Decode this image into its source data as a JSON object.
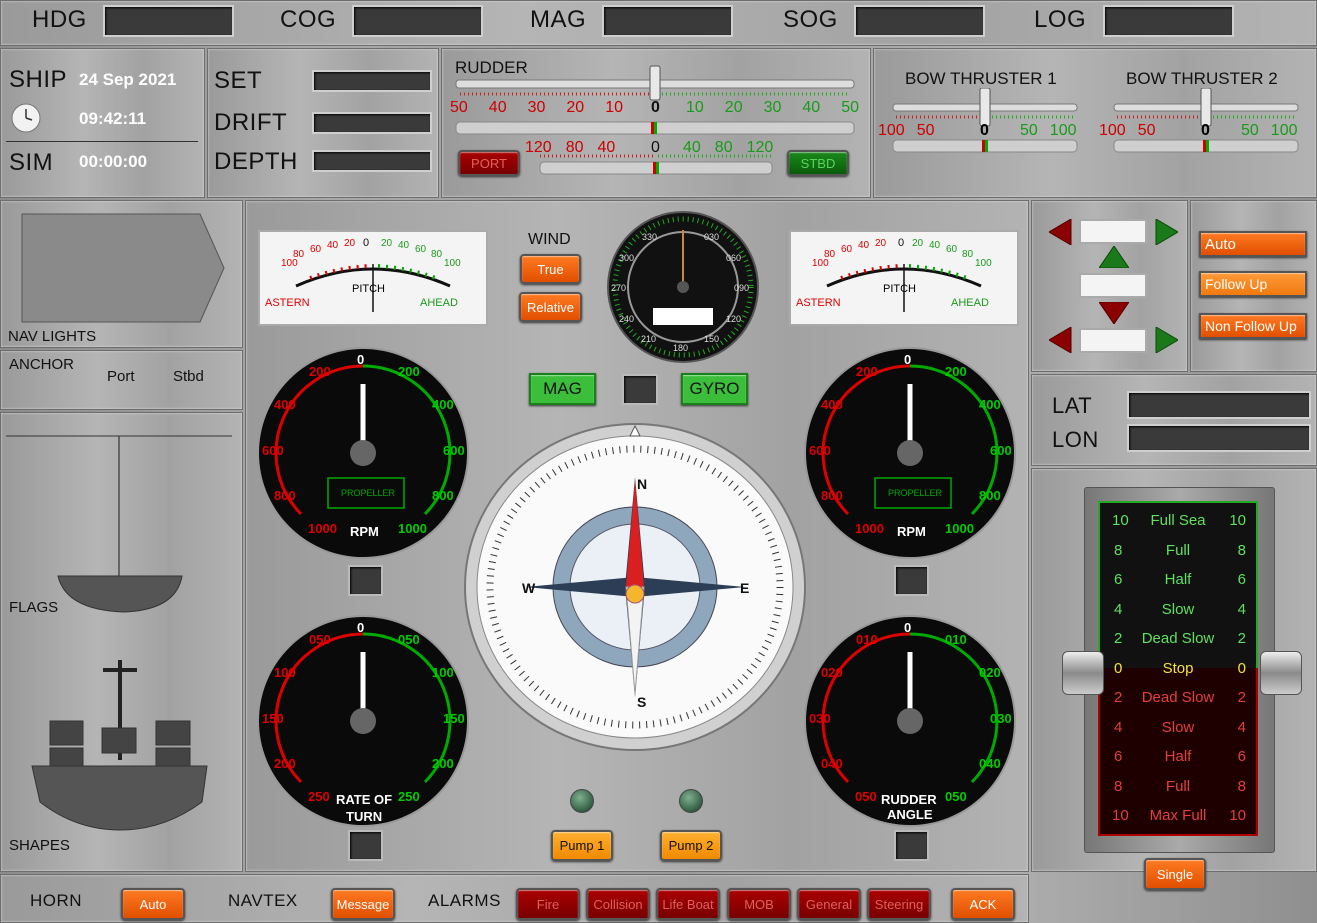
{
  "topbar": {
    "labels": [
      "HDG",
      "COG",
      "MAG",
      "SOG",
      "LOG"
    ]
  },
  "clock": {
    "ship_label": "SHIP",
    "date": "24 Sep 2021",
    "time": "09:42:11",
    "sim_label": "SIM",
    "sim_time": "00:00:00"
  },
  "set_panel": {
    "set": "SET",
    "drift": "DRIFT",
    "depth": "DEPTH"
  },
  "rudder": {
    "title": "RUDDER",
    "left_ticks": [
      "50",
      "40",
      "30",
      "20",
      "10"
    ],
    "center": "0",
    "right_ticks": [
      "10",
      "20",
      "30",
      "40",
      "50"
    ],
    "small_left": [
      "120",
      "80",
      "40"
    ],
    "small_center": "0",
    "small_right": [
      "40",
      "80",
      "120"
    ],
    "port_label": "PORT",
    "stbd_label": "STBD"
  },
  "thrusters": [
    {
      "title": "BOW THRUSTER 1",
      "left": [
        "100",
        "50"
      ],
      "center": "0",
      "right": [
        "50",
        "100"
      ]
    },
    {
      "title": "BOW THRUSTER 2",
      "left": [
        "100",
        "50"
      ],
      "center": "0",
      "right": [
        "50",
        "100"
      ]
    }
  ],
  "left_panel": {
    "nav_lights": "NAV LIGHTS",
    "anchor": "ANCHOR",
    "port": "Port",
    "stbd": "Stbd",
    "flags": "FLAGS",
    "shapes": "SHAPES"
  },
  "pitch": {
    "left_nums": [
      "100",
      "80",
      "60",
      "40",
      "20"
    ],
    "zero": "0",
    "right_nums": [
      "20",
      "40",
      "60",
      "80",
      "100"
    ],
    "label": "PITCH",
    "astern": "ASTERN",
    "ahead": "AHEAD"
  },
  "wind": {
    "title": "WIND",
    "true_label": "True",
    "relative_label": "Relative",
    "dial_labels": [
      "330",
      "030",
      "300",
      "060",
      "270",
      "090",
      "240",
      "120",
      "210",
      "180",
      "150"
    ]
  },
  "heading_mode": {
    "mag": "MAG",
    "gyro": "GYRO"
  },
  "rpm": {
    "top": "0",
    "l1": "200",
    "l2": "400",
    "l3": "600",
    "l4": "800",
    "l5": "1000",
    "r1": "200",
    "r2": "400",
    "r3": "600",
    "r4": "800",
    "r5": "1000",
    "label": "RPM",
    "box": "PROPELLER"
  },
  "rot": {
    "top": "0",
    "l1": "050",
    "l2": "100",
    "l3": "150",
    "l4": "200",
    "l5": "250",
    "r1": "050",
    "r2": "100",
    "r3": "150",
    "r4": "200",
    "r5": "250",
    "label1": "RATE OF",
    "label2": "TURN"
  },
  "rudder_angle": {
    "top": "0",
    "l1": "010",
    "l2": "020",
    "l3": "030",
    "l4": "040",
    "l5": "050",
    "r1": "010",
    "r2": "020",
    "r3": "030",
    "r4": "040",
    "r5": "050",
    "label1": "RUDDER",
    "label2": "ANGLE"
  },
  "compass": {
    "N": "N",
    "E": "E",
    "S": "S",
    "W": "W"
  },
  "pumps": {
    "pump1": "Pump 1",
    "pump2": "Pump 2"
  },
  "steering_modes": {
    "auto": "Auto",
    "follow_up": "Follow Up",
    "non_follow_up": "Non Follow Up"
  },
  "position": {
    "lat": "LAT",
    "lon": "LON"
  },
  "telegraph": {
    "rows": [
      {
        "l": "10",
        "name": "Full Sea",
        "r": "10",
        "color": "#5fe05f"
      },
      {
        "l": "8",
        "name": "Full",
        "r": "8",
        "color": "#5fe05f"
      },
      {
        "l": "6",
        "name": "Half",
        "r": "6",
        "color": "#5fe05f"
      },
      {
        "l": "4",
        "name": "Slow",
        "r": "4",
        "color": "#5fe05f"
      },
      {
        "l": "2",
        "name": "Dead Slow",
        "r": "2",
        "color": "#5fe05f"
      },
      {
        "l": "0",
        "name": "Stop",
        "r": "0",
        "color": "#f2e23a"
      },
      {
        "l": "2",
        "name": "Dead Slow",
        "r": "2",
        "color": "#e04040"
      },
      {
        "l": "4",
        "name": "Slow",
        "r": "4",
        "color": "#e04040"
      },
      {
        "l": "6",
        "name": "Half",
        "r": "6",
        "color": "#e04040"
      },
      {
        "l": "8",
        "name": "Full",
        "r": "8",
        "color": "#e04040"
      },
      {
        "l": "10",
        "name": "Max Full",
        "r": "10",
        "color": "#e04040"
      }
    ],
    "single_label": "Single"
  },
  "bottom": {
    "horn": "HORN",
    "horn_btn": "Auto",
    "navtex": "NAVTEX",
    "navtex_btn": "Message",
    "alarms": "ALARMS",
    "alarm_buttons": [
      "Fire",
      "Collision",
      "Life Boat",
      "MOB",
      "General",
      "Steering"
    ],
    "ack": "ACK"
  }
}
